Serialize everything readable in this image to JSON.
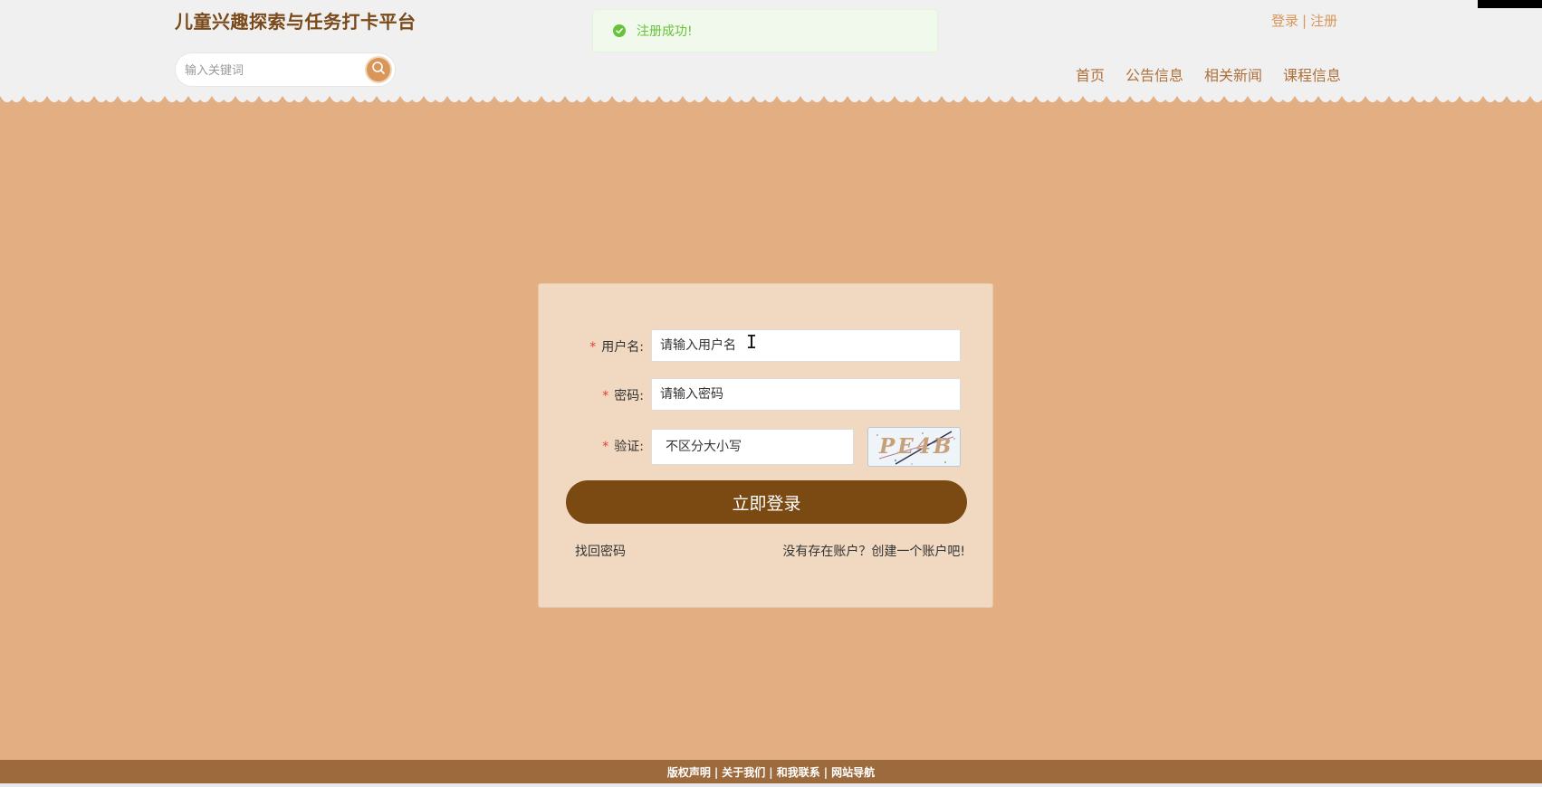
{
  "header": {
    "site_title": "儿童兴趣探索与任务打卡平台",
    "search": {
      "placeholder": "输入关键词"
    },
    "auth": {
      "login": "登录",
      "separator": "|",
      "register": "注册"
    },
    "nav": [
      {
        "label": "首页"
      },
      {
        "label": "公告信息"
      },
      {
        "label": "相关新闻"
      },
      {
        "label": "课程信息"
      }
    ]
  },
  "toast": {
    "message": "注册成功!",
    "type": "success"
  },
  "login_form": {
    "required_mark": "*",
    "username": {
      "label": "用户名:",
      "placeholder": "请输入用户名"
    },
    "password": {
      "label": "密码:",
      "placeholder": "请输入密码"
    },
    "captcha": {
      "label": "验证:",
      "placeholder": "不区分大小写",
      "image_text": "PE4B"
    },
    "submit_label": "立即登录",
    "forgot_password": "找回密码",
    "register_prompt": "没有存在账户？创建一个账户吧!"
  },
  "footer": {
    "links": [
      {
        "label": "版权声明"
      },
      {
        "label": "关于我们"
      },
      {
        "label": "和我联系"
      },
      {
        "label": "网站导航"
      }
    ],
    "separator": "|"
  },
  "colors": {
    "page_bg": "#e2ae82",
    "header_bg": "#f0f0f0",
    "brand": "#7b4a13",
    "accent": "#d8965a",
    "card_bg": "#f1d8c1",
    "footer_bg": "#9c6a3c",
    "success": "#67c23a"
  },
  "icons": [
    "search-icon",
    "check-circle-icon",
    "text-cursor-icon"
  ]
}
